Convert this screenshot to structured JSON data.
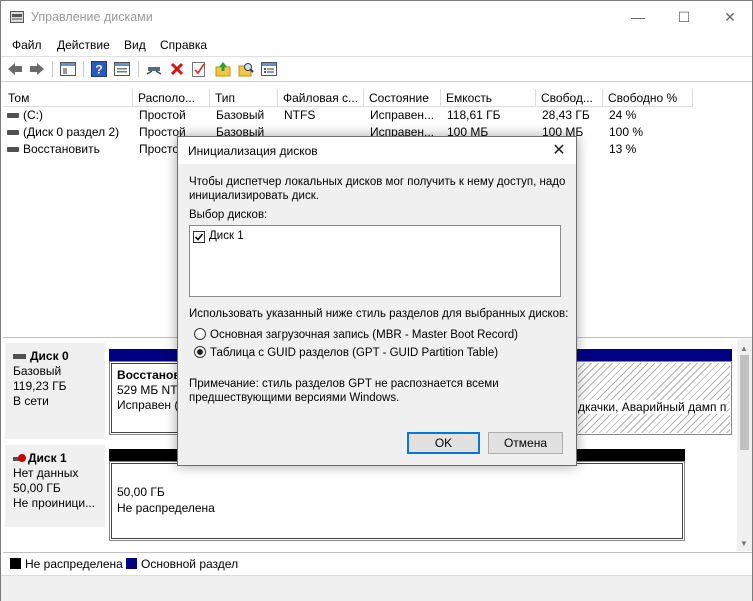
{
  "window": {
    "title": "Управление дисками",
    "min": "—",
    "max": "☐",
    "close": "✕"
  },
  "menu": [
    "Файл",
    "Действие",
    "Вид",
    "Справка"
  ],
  "table": {
    "headers": [
      "Том",
      "Располо...",
      "Тип",
      "Файловая с...",
      "Состояние",
      "Емкость",
      "Свобод...",
      "Свободно %"
    ],
    "rows": [
      [
        "(C:)",
        "Простой",
        "Базовый",
        "NTFS",
        "Исправен...",
        "118,61 ГБ",
        "28,43 ГБ",
        "24 %"
      ],
      [
        "(Диск 0 раздел 2)",
        "Простой",
        "Базовый",
        "",
        "Исправен...",
        "100 МБ",
        "100 МБ",
        "100 %"
      ],
      [
        "Восстановить",
        "Простой",
        "",
        "",
        "",
        "",
        "",
        "13 %"
      ]
    ]
  },
  "disks": [
    {
      "name": "Диск 0",
      "type": "Базовый",
      "size": "119,23 ГБ",
      "status": "В сети",
      "partition": {
        "name": "Восстанови",
        "size": "529 МБ NTF",
        "status": "Исправен ("
      },
      "partition_tail": "дкачки, Аварийный дамп п"
    },
    {
      "name": "Диск 1",
      "type": "Нет данных",
      "size": "50,00 ГБ",
      "status": "Не проиници...",
      "partition": {
        "size": "50,00 ГБ",
        "status": "Не распределена"
      }
    }
  ],
  "legend": [
    {
      "label": "Не распределена",
      "color": "#000000"
    },
    {
      "label": "Основной раздел",
      "color": "#000080"
    }
  ],
  "dialog": {
    "title": "Инициализация дисков",
    "intro": "Чтобы диспетчер локальных дисков мог получить к нему доступ, надо инициализировать диск.",
    "select_label": "Выбор дисков:",
    "disk_item": "Диск 1",
    "style_label": "Использовать указанный ниже стиль разделов для выбранных дисков:",
    "option_mbr": "Основная загрузочная запись (MBR - Master Boot Record)",
    "option_gpt": "Таблица с GUID разделов (GPT - GUID Partition Table)",
    "selected_option": "GPT",
    "note": "Примечание: стиль разделов GPT не распознается всеми предшествующими версиями Windows.",
    "ok": "OK",
    "cancel": "Отмена"
  },
  "colors": {
    "primary_partition": "#000080",
    "unallocated": "#000000",
    "hatch": "#b0b0b0"
  },
  "icons": [
    "back-icon",
    "forward-icon",
    "console-icon",
    "help-icon",
    "properties-icon",
    "connect-icon",
    "delete-icon",
    "check-icon",
    "up-icon",
    "search-icon",
    "list-icon"
  ]
}
